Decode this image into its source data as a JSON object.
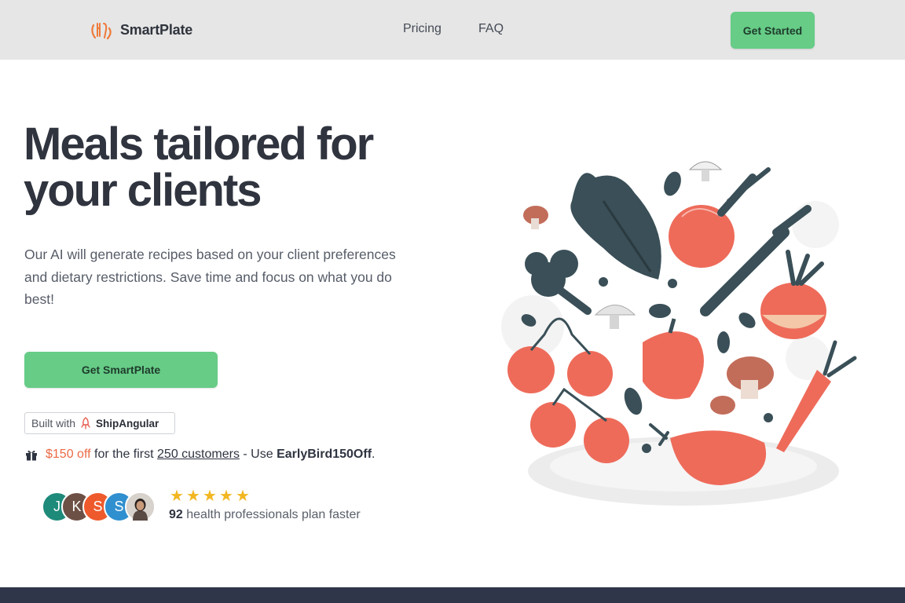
{
  "header": {
    "brand": "SmartPlate",
    "nav": {
      "pricing": "Pricing",
      "faq": "FAQ"
    },
    "cta": "Get Started"
  },
  "hero": {
    "title_line1": "Meals tailored for",
    "title_line2": "your clients",
    "description": "Our AI will generate recipes based on your client preferences and dietary restrictions. Save time and focus on what you do best!",
    "cta": "Get SmartPlate"
  },
  "built_with": {
    "prefix": "Built with",
    "brand": "ShipAngular"
  },
  "promo": {
    "discount": "$150 off",
    "middle": " for the first ",
    "link": "250 customers",
    "dash": " - Use ",
    "code": "EarlyBird150Off",
    "end": "."
  },
  "social_proof": {
    "avatars": [
      {
        "initial": "J",
        "color": "#1e8a7a"
      },
      {
        "initial": "K",
        "color": "#6d5045"
      },
      {
        "initial": "S",
        "color": "#ee5a2c"
      },
      {
        "initial": "S",
        "color": "#2f8fcf"
      }
    ],
    "star_count": 5,
    "stars": [
      "★",
      "★",
      "★",
      "★",
      "★"
    ],
    "count": "92",
    "text": " health professionals plan faster"
  },
  "colors": {
    "accent_green": "#66cc86",
    "promo_orange": "#ec6a45",
    "star_yellow": "#f2b722",
    "dark_text": "#30343f",
    "footer": "#30364a"
  },
  "icons": [
    "smartplate-logo-icon",
    "rocket-icon",
    "gift-icon",
    "star-icon",
    "vegetables-illustration"
  ]
}
